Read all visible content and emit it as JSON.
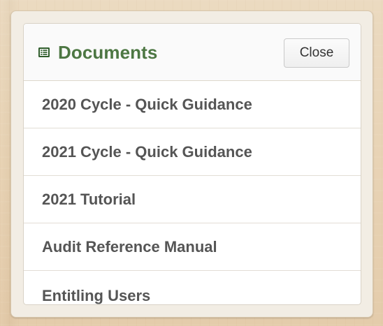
{
  "documents_panel": {
    "title": "Documents",
    "title_icon": "document-list-icon",
    "close_label": "Close",
    "items": [
      {
        "label": "2020 Cycle - Quick Guidance"
      },
      {
        "label": "2021 Cycle - Quick Guidance"
      },
      {
        "label": "2021 Tutorial"
      },
      {
        "label": "Audit Reference Manual"
      },
      {
        "label": "Entitling Users"
      }
    ]
  },
  "colors": {
    "title": "#4d7743",
    "item_text": "#555555",
    "background": "#e7d1b1",
    "panel_background": "#ffffff",
    "border": "#ddd7cc"
  }
}
